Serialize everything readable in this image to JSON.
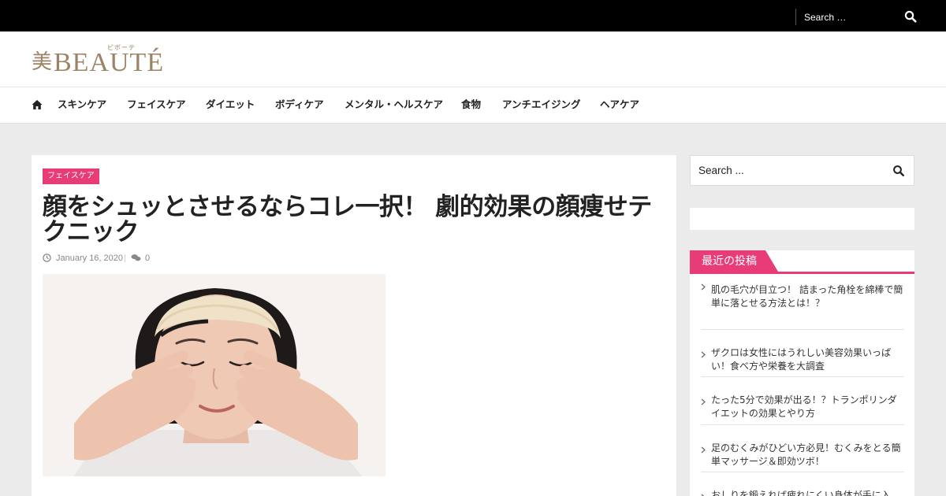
{
  "topbar": {
    "search_placeholder": "Search …",
    "search_icon": "search-icon"
  },
  "header": {
    "logo_kanji": "美",
    "logo_text": "BEAUTÉ",
    "logo_ruby": "ビボーテ"
  },
  "nav": {
    "home_icon": "home-icon",
    "items": [
      "スキンケア",
      "フェイスケア",
      "ダイエット",
      "ボディケア",
      "メンタル・ヘルスケア",
      "食物",
      "アンチエイジング",
      "ヘアケア"
    ]
  },
  "post": {
    "category": "フェイスケア",
    "title": "顔をシュッとさせるならコレ一択！ 劇的効果の顔痩せテクニック",
    "date": "January 16, 2020",
    "comments": "0",
    "image_subject": "woman-massaging-cheeks"
  },
  "sidebar": {
    "search_placeholder": "Search ...",
    "recent_title": "最近の投稿",
    "recent_posts": [
      "肌の毛穴が目立つ！ 詰まった角栓を綿棒で簡単に落とせる方法とは！？",
      "ザクロは女性にはうれしい美容効果いっぱい！食べ方や栄養を大調査",
      "たった5分で効果が出る！？トランポリンダイエットの効果とやり方",
      "足のむくみがひどい方必見！むくみをとる簡単マッサージ＆即効ツボ！",
      "おしりを鍛えれば疲れにくい身体が手に入る！今すぐできる超簡単メソッド"
    ]
  },
  "colors": {
    "accent": "#e73c78",
    "logo": "#9b8466",
    "topbar": "#000000",
    "background": "#ebebeb"
  }
}
